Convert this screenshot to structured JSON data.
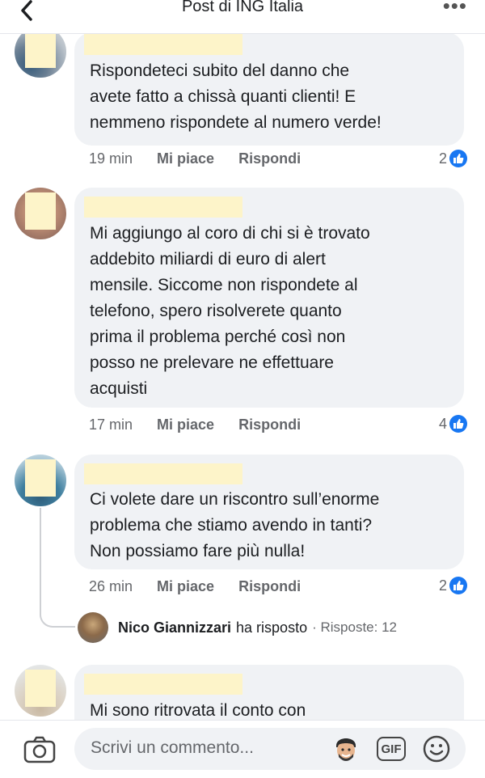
{
  "header": {
    "title": "Post di ING Italia",
    "back_icon": "chevron-left-icon",
    "more_icon": "more-icon",
    "more_glyph": "•••"
  },
  "comments": [
    {
      "lines": [
        "Rispondeteci subito del danno che",
        "avete fatto a chissà quanti clienti! E",
        "nemmeno rispondete al numero verde!"
      ],
      "time": "19 min",
      "like_label": "Mi piace",
      "reply_label": "Rispondi",
      "reactions": "2"
    },
    {
      "lines": [
        "Mi aggiungo al coro di chi si è trovato",
        "addebito miliardi di euro di alert",
        "mensile. Siccome non rispondete al",
        "telefono, spero risolverete quanto",
        "prima il problema perché così non",
        "posso ne prelevare ne effettuare",
        "acquisti"
      ],
      "time": "17 min",
      "like_label": "Mi piace",
      "reply_label": "Rispondi",
      "reactions": "4"
    },
    {
      "lines": [
        "Ci volete dare un riscontro sull’enorme",
        "problema che stiamo avendo in tanti?",
        "Non possiamo fare più nulla!"
      ],
      "time": "26 min",
      "like_label": "Mi piace",
      "reply_label": "Rispondi",
      "reactions": "2",
      "reply_summary": {
        "name": "Nico Giannizzari",
        "verb": "ha risposto",
        "count": "· Risposte: 12"
      }
    },
    {
      "lines": [
        "Mi sono ritrovata il conto con"
      ]
    }
  ],
  "composer": {
    "placeholder": "Scrivi un commento...",
    "gif_label": "GIF",
    "camera_icon": "camera-icon",
    "emoji_icon": "avatar-emoji-icon",
    "smile_icon": "smiley-icon"
  },
  "colors": {
    "like_blue": "#1877f2",
    "bubble_bg": "#f0f2f5",
    "redaction": "#fdf4c9"
  }
}
